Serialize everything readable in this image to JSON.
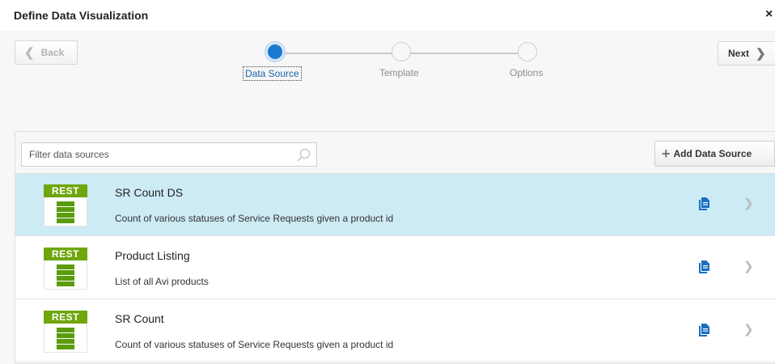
{
  "dialog": {
    "title": "Define Data Visualization",
    "close_label": "×"
  },
  "train": {
    "back_label": "Back",
    "next_label": "Next",
    "stops": [
      {
        "label": "Data Source",
        "state": "active"
      },
      {
        "label": "Template",
        "state": "inactive"
      },
      {
        "label": "Options",
        "state": "inactive"
      }
    ]
  },
  "toolbar": {
    "filter_placeholder": "Filter data sources",
    "filter_value": "",
    "add_label": "Add Data Source"
  },
  "data_sources": [
    {
      "type": "REST",
      "name": "SR Count DS",
      "description": "Count of various statuses of Service Requests given a product id",
      "selected": true
    },
    {
      "type": "REST",
      "name": "Product Listing",
      "description": "List of all Avi products",
      "selected": false
    },
    {
      "type": "REST",
      "name": "SR Count",
      "description": "Count of various statuses of Service Requests given a product id",
      "selected": false
    }
  ],
  "colors": {
    "accent": "#1a78d0",
    "rest_green": "#6ea60e",
    "selected_row": "#cdebf5"
  },
  "icons": [
    "close-icon",
    "chevron-left-icon",
    "chevron-right-icon",
    "search-icon",
    "plus-icon",
    "rest-datasource-icon",
    "document-icon"
  ]
}
